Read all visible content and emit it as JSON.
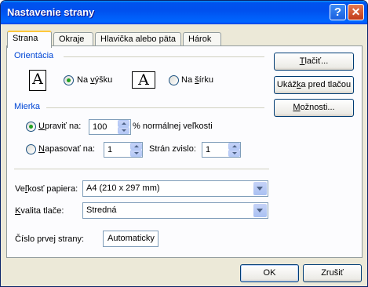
{
  "window": {
    "title": "Nastavenie strany",
    "help_label": "?",
    "close_label": "✕"
  },
  "tabs": [
    {
      "label": "Strana",
      "active": true
    },
    {
      "label": "Okraje",
      "active": false
    },
    {
      "label": "Hlavička alebo päta",
      "active": false
    },
    {
      "label": "Hárok",
      "active": false
    }
  ],
  "orientation": {
    "group_label": "Orientácia",
    "icon_glyph": "A",
    "portrait": {
      "label_pre": "Na ",
      "label_u": "v",
      "label_post": "ýšku",
      "selected": true,
      "icon": "portrait-page-icon"
    },
    "landscape": {
      "label_pre": "Na ",
      "label_u": "š",
      "label_post": "írku",
      "selected": false,
      "icon": "landscape-page-icon"
    }
  },
  "scale": {
    "group_label": "Mierka",
    "adjust": {
      "label_u": "U",
      "label_post": "praviť na:",
      "value": "100",
      "suffix": "% normálnej veľkosti",
      "selected": true
    },
    "fit": {
      "label_u": "N",
      "label_post": "apasovať na:",
      "wide_value": "1",
      "tall_label": "Strán zvislo:",
      "tall_value": "1",
      "selected": false
    }
  },
  "paper_size": {
    "label_pre": "Ve",
    "label_u": "ľ",
    "label_post": "kosť papiera:",
    "value": "A4 (210 x 297 mm)"
  },
  "print_quality": {
    "label_u": "K",
    "label_post": "valita tlače:",
    "value": "Stredná"
  },
  "first_page": {
    "label": "Číslo prvej strany:",
    "value": "Automaticky"
  },
  "side_buttons": {
    "print": {
      "label_u": "T",
      "label_post": "lačiť..."
    },
    "preview": {
      "label_pre": "Ukáž",
      "label_u": "k",
      "label_post": "a pred tlačou"
    },
    "options": {
      "label_u": "M",
      "label_post": "ožnosti..."
    }
  },
  "footer": {
    "ok": "OK",
    "cancel": "Zrušiť"
  },
  "colors": {
    "title_bar": "#0054e3",
    "group_label": "#0046d5",
    "dialog_bg": "#ece9d8"
  }
}
